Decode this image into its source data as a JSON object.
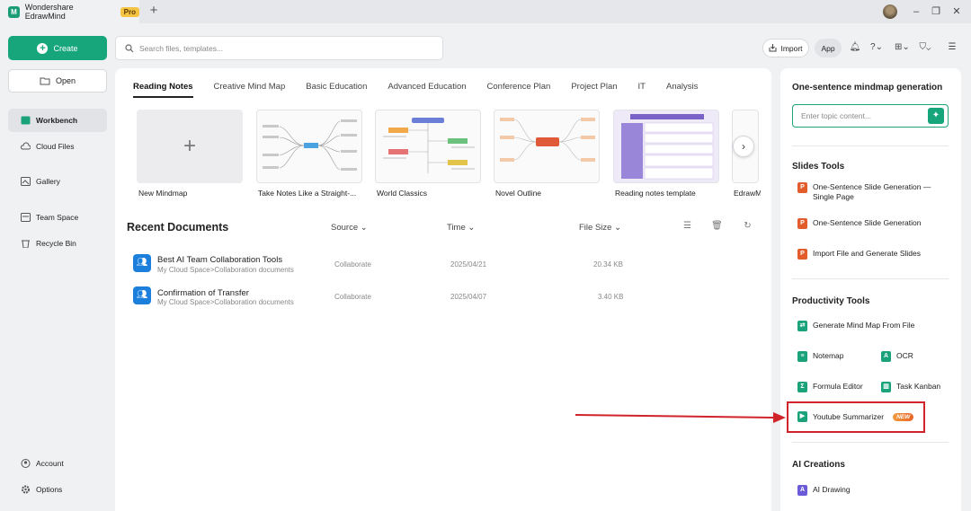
{
  "titlebar": {
    "app_title": "Wondershare EdrawMind",
    "pro_badge": "Pro",
    "new_tab": "+",
    "minimize": "–",
    "restore": "❐",
    "close": "✕"
  },
  "sidebar": {
    "create_label": "Create",
    "open_label": "Open",
    "items": [
      {
        "label": "Workbench",
        "icon": "workbench-icon"
      },
      {
        "label": "Cloud Files",
        "icon": "cloud-icon"
      },
      {
        "label": "Gallery",
        "icon": "gallery-icon"
      },
      {
        "label": "Team Space",
        "icon": "team-space-icon"
      },
      {
        "label": "Recycle Bin",
        "icon": "recycle-bin-icon"
      }
    ],
    "bottom": [
      {
        "label": "Account",
        "icon": "account-icon"
      },
      {
        "label": "Options",
        "icon": "gear-icon"
      }
    ]
  },
  "search": {
    "placeholder": "Search files, templates..."
  },
  "toolbar": {
    "import_label": "Import",
    "app_label": "App"
  },
  "tabs": [
    "Reading Notes",
    "Creative Mind Map",
    "Basic Education",
    "Advanced Education",
    "Conference Plan",
    "Project Plan",
    "IT",
    "Analysis"
  ],
  "templates": [
    {
      "label": "New Mindmap"
    },
    {
      "label": "Take Notes Like a Straight-..."
    },
    {
      "label": "World Classics"
    },
    {
      "label": "Novel Outline"
    },
    {
      "label": "Reading notes template"
    },
    {
      "label": "EdrawM"
    }
  ],
  "recent": {
    "title": "Recent Documents",
    "columns": {
      "source": "Source",
      "time": "Time",
      "size": "File Size"
    },
    "docs": [
      {
        "title": "Best AI Team Collaboration Tools",
        "path": "My Cloud Space>Collaboration documents",
        "source": "Collaborate",
        "time": "2025/04/21",
        "size": "20.34 KB"
      },
      {
        "title": "Confirmation of Transfer",
        "path": "My Cloud Space>Collaboration documents",
        "source": "Collaborate",
        "time": "2025/04/07",
        "size": "3.40 KB"
      }
    ]
  },
  "right": {
    "gen_title": "One-sentence mindmap generation",
    "topic_placeholder": "Enter topic content...",
    "slides_title": "Slides Tools",
    "slides": [
      "One-Sentence Slide Generation — Single Page",
      "One-Sentence Slide Generation",
      "Import File and Generate Slides"
    ],
    "productivity_title": "Productivity Tools",
    "productivity": {
      "gen_from_file": "Generate Mind Map From File",
      "notemap": "Notemap",
      "ocr": "OCR",
      "formula": "Formula Editor",
      "kanban": "Task Kanban",
      "youtube": "Youtube Summarizer",
      "new_badge": "NEW"
    },
    "ai_title": "AI Creations",
    "ai_drawing": "AI Drawing"
  },
  "colors": {
    "accent": "#17a57b",
    "highlight": "#d0232a",
    "doc_icon": "#1c7fdc"
  }
}
